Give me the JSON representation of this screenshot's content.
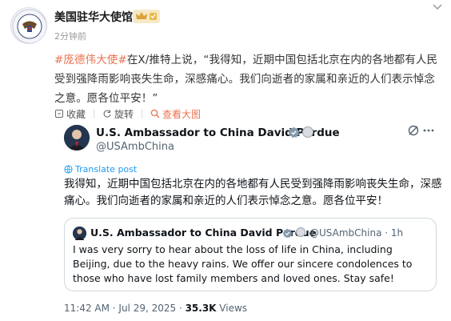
{
  "account": {
    "name": "美国驻华大使馆",
    "time": "2分钟前"
  },
  "post": {
    "tag1": "#庞德伟大使#",
    "text1": "在X/推特上说，“我得知，近期中国包括北京在内的各地都有人民受到强降雨影响丧失生命，深感痛心。我们向逝者的家属和亲近的人们表示悼念之意。愿各位平安！”"
  },
  "actions": {
    "collect": "收藏",
    "rotate": "旋转",
    "view_big": "查看大图"
  },
  "tweet": {
    "name": "U.S. Ambassador to China David Perdue",
    "handle": "@USAmbChina",
    "translate": "Translate post",
    "text": "我得知，近期中国包括北京在内的各地都有人民受到强降雨影响丧失生命，深感痛心。我们向逝者的家属和亲近的人们表示悼念之意。愿各位平安！",
    "meta_time": "11:42 AM · Jul 29, 2025 · ",
    "views_count": "35.3K",
    "views_label": " Views"
  },
  "quote": {
    "name": "U.S. Ambassador to China David Perdue",
    "handle": "@USAmbChina · 1h",
    "text": "I was very sorry to hear about the loss of life in China, including Beijing, due to the heavy rains. We offer our sincere condolences to those who have lost family members and loved ones. Stay safe!"
  },
  "colors": {
    "accent": "#eb7350",
    "twitter_blue": "#1d9bf0",
    "vip_gold": "#f6e9c4"
  }
}
